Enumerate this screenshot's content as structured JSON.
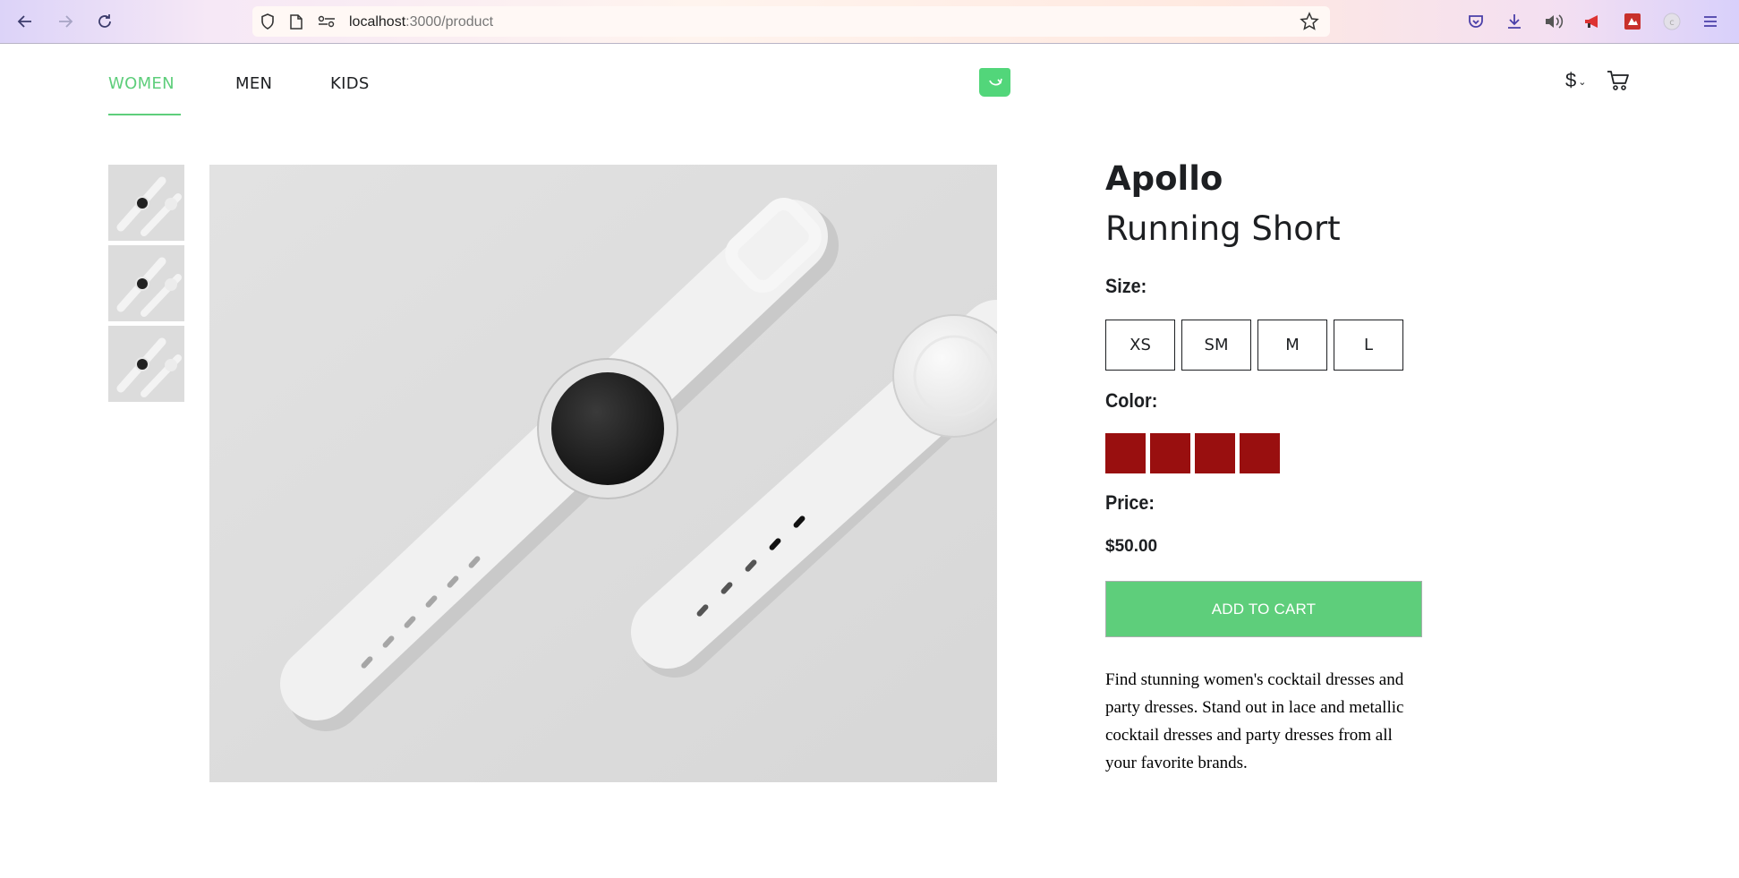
{
  "browser": {
    "url_host": "localhost",
    "url_path": ":3000/product"
  },
  "nav": {
    "categories": [
      {
        "label": "WOMEN",
        "active": true
      },
      {
        "label": "MEN",
        "active": false
      },
      {
        "label": "KIDS",
        "active": false
      }
    ],
    "currency_symbol": "$",
    "accent_color": "#5ece7b"
  },
  "product": {
    "brand": "Apollo",
    "name": "Running Short",
    "size_label": "Size:",
    "sizes": [
      "XS",
      "SM",
      "M",
      "L"
    ],
    "color_label": "Color:",
    "colors": [
      "#990f0f",
      "#990f0f",
      "#990f0f",
      "#990f0f"
    ],
    "price_label": "Price:",
    "price": "$50.00",
    "add_to_cart_label": "ADD TO CART",
    "description": "Find stunning women's cocktail dresses and party dresses. Stand out in lace and metallic cocktail dresses and party dresses from all your favorite brands."
  }
}
